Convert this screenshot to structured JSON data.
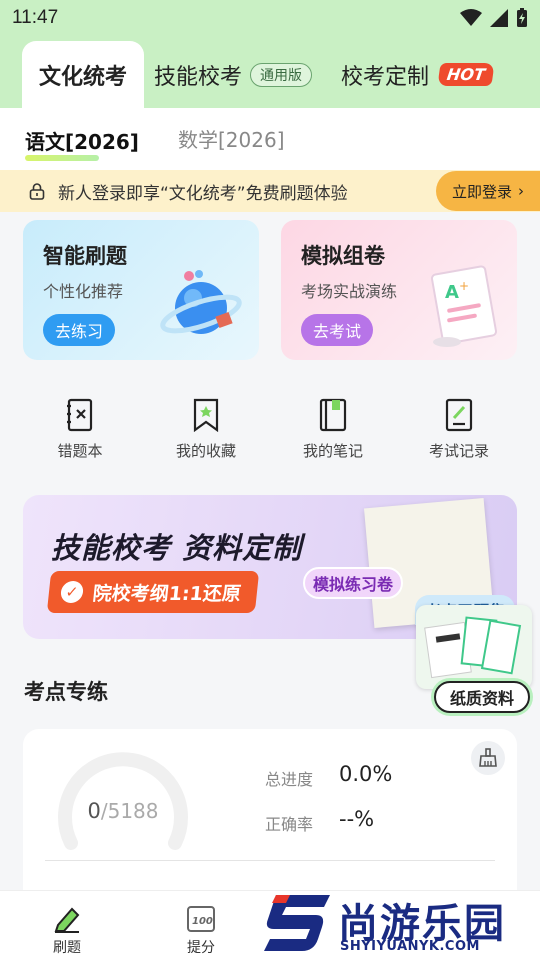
{
  "status_bar": {
    "time": "11:47"
  },
  "top_tabs": [
    {
      "label": "文化统考"
    },
    {
      "label": "技能校考",
      "badge": "通用版"
    },
    {
      "label": "校考定制",
      "badge": "HOT"
    }
  ],
  "sub_tabs": [
    {
      "label": "语文[2026]"
    },
    {
      "label": "数学[2026]"
    }
  ],
  "notice": {
    "text": "新人登录即享“文化统考”免费刷题体验",
    "button": "立即登录"
  },
  "cards": [
    {
      "title": "智能刷题",
      "subtitle": "个性化推荐",
      "button": "去练习"
    },
    {
      "title": "模拟组卷",
      "subtitle": "考场实战演练",
      "button": "去考试"
    }
  ],
  "quick_actions": [
    {
      "label": "错题本",
      "icon": "wrong-book-icon"
    },
    {
      "label": "我的收藏",
      "icon": "bookmark-icon"
    },
    {
      "label": "我的笔记",
      "icon": "notebook-icon"
    },
    {
      "label": "考试记录",
      "icon": "exam-record-icon"
    }
  ],
  "banner": {
    "headline": "技能校考  资料定制",
    "ribbon": "院校考纲1:1还原",
    "tag1": "模拟练习卷",
    "tag2": "考点习题集"
  },
  "floating_sticker": {
    "label": "纸质资料"
  },
  "section": {
    "title": "考点专练"
  },
  "progress_card": {
    "done": "0",
    "total": "/5188",
    "total_progress_label": "总进度",
    "total_progress_value": "0.0%",
    "accuracy_label": "正确率",
    "accuracy_value": "--%"
  },
  "bottom_nav": [
    {
      "label": "刷题"
    },
    {
      "label": "提分"
    }
  ],
  "watermark": {
    "name": "尚游乐园",
    "url": "SHYIYUANYK.COM"
  },
  "colors": {
    "header_green": "#c9f0c4",
    "orange": "#f6b544",
    "blue": "#2f9cf2",
    "purple": "#b774e8",
    "navy": "#1a2b82"
  }
}
